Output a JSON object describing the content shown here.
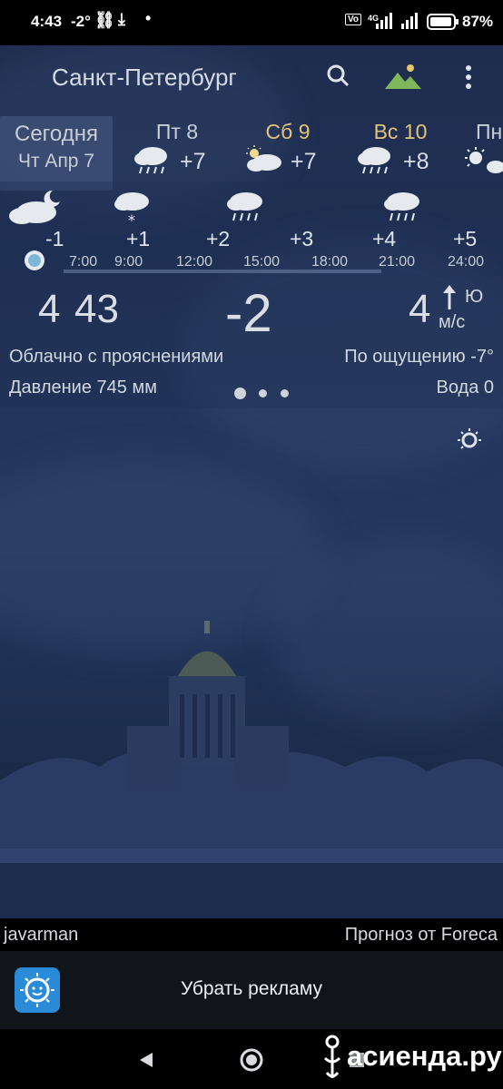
{
  "status_bar": {
    "time": "4:43",
    "temp": "-2°",
    "battery": "87%",
    "network": "4G"
  },
  "header": {
    "city": "Санкт-Петербург"
  },
  "days": [
    {
      "name": "Сегодня",
      "date": "Чт Апр 7",
      "temp": "",
      "weekend": false
    },
    {
      "name": "Пт 8",
      "date": "",
      "temp": "+7",
      "weekend": false
    },
    {
      "name": "Сб 9",
      "date": "",
      "temp": "+7",
      "weekend": true
    },
    {
      "name": "Вс 10",
      "date": "",
      "temp": "+8",
      "weekend": true
    },
    {
      "name": "Пн",
      "date": "",
      "temp": "",
      "weekend": false
    }
  ],
  "hourly": {
    "temps": [
      "-1",
      "+1",
      "+2",
      "+3",
      "+4",
      "+5"
    ],
    "times": [
      "7:00",
      "9:00",
      "12:00",
      "15:00",
      "18:00",
      "21:00",
      "24:00"
    ]
  },
  "current": {
    "time_hours": "4",
    "time_minutes": "43",
    "temperature": "-2",
    "wind_speed": "4",
    "wind_direction": "Ю",
    "wind_unit": "м/с",
    "condition": "Облачно с прояснениями",
    "feels_like": "По ощущению -7°",
    "pressure": "Давление 745 мм",
    "precipitation": "Вода 0"
  },
  "credits": {
    "user": "javarman",
    "provider": "Прогноз от Foreca"
  },
  "ad": {
    "label": "Убрать рекламу"
  },
  "watermark": "асиенда.ру",
  "colors": {
    "weekend": "#e2c37a",
    "ad_icon": "#2a8bd8",
    "background": "#22345a"
  }
}
